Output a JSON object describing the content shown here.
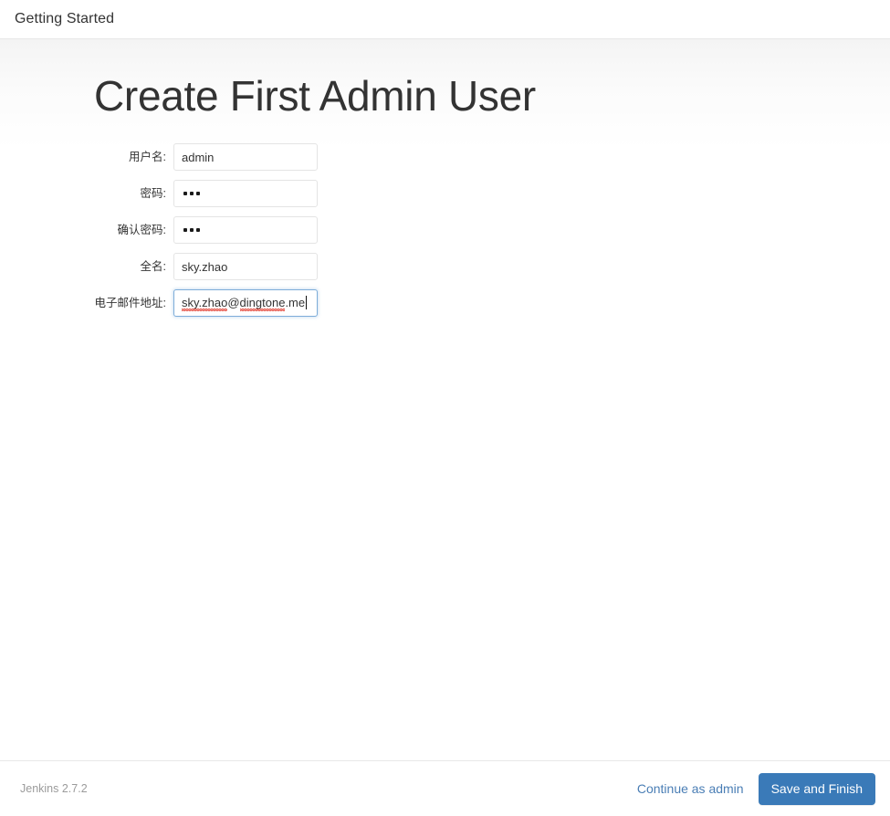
{
  "header": {
    "title": "Getting Started"
  },
  "main": {
    "page_title": "Create First Admin User",
    "fields": [
      {
        "name": "username",
        "label": "用户名:",
        "value": "admin",
        "type": "text",
        "focused": false
      },
      {
        "name": "password",
        "label": "密码:",
        "value": "•••",
        "masked_char_count": 3,
        "type": "password",
        "focused": false
      },
      {
        "name": "confirm-password",
        "label": "确认密码:",
        "value": "•••",
        "masked_char_count": 3,
        "type": "password",
        "focused": false
      },
      {
        "name": "fullname",
        "label": "全名:",
        "value": "sky.zhao",
        "type": "text",
        "focused": false
      },
      {
        "name": "email",
        "label": "电子邮件地址:",
        "value": "sky.zhao@dingtone.me",
        "value_parts": {
          "misspelled_one": "sky.zhao",
          "at": "@",
          "misspelled_two": "dingtone",
          "tail": ".me"
        },
        "type": "email",
        "focused": true,
        "spellcheck_underline": true,
        "caret_visible": true
      }
    ]
  },
  "footer": {
    "version": "Jenkins 2.7.2",
    "continue_link": "Continue as admin",
    "save_button": "Save and Finish"
  },
  "colors": {
    "accent_blue": "#3a7ab8",
    "link_blue": "#4a7eb5",
    "focus_border": "#7eadd9",
    "text_dark": "#333333",
    "text_muted": "#9b9b9b",
    "field_border": "#e4e4e4",
    "spellcheck_red": "#e23b2e"
  }
}
